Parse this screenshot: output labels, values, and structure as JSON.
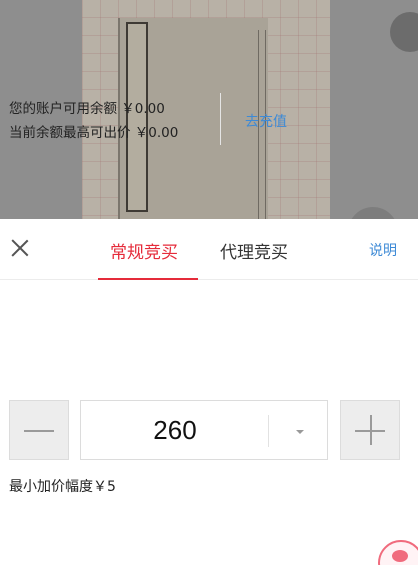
{
  "tabs": {
    "active_label": "常规竞买",
    "proxy_label": "代理竞买"
  },
  "help_label": "说明",
  "account": {
    "balance_line": "您的账户可用余额 ￥0.00",
    "max_bid_line": "当前余额最高可出价 ￥0.00",
    "recharge_label": "去充值"
  },
  "bid": {
    "value": "260"
  },
  "min_increment": "最小加价幅度￥5",
  "colors": {
    "accent_red": "#e52b3a",
    "link_blue": "#3d8ad6"
  },
  "icons": {
    "close": "close-icon",
    "minus": "minus-icon",
    "plus": "plus-icon",
    "dropdown": "chevron-down-icon"
  }
}
